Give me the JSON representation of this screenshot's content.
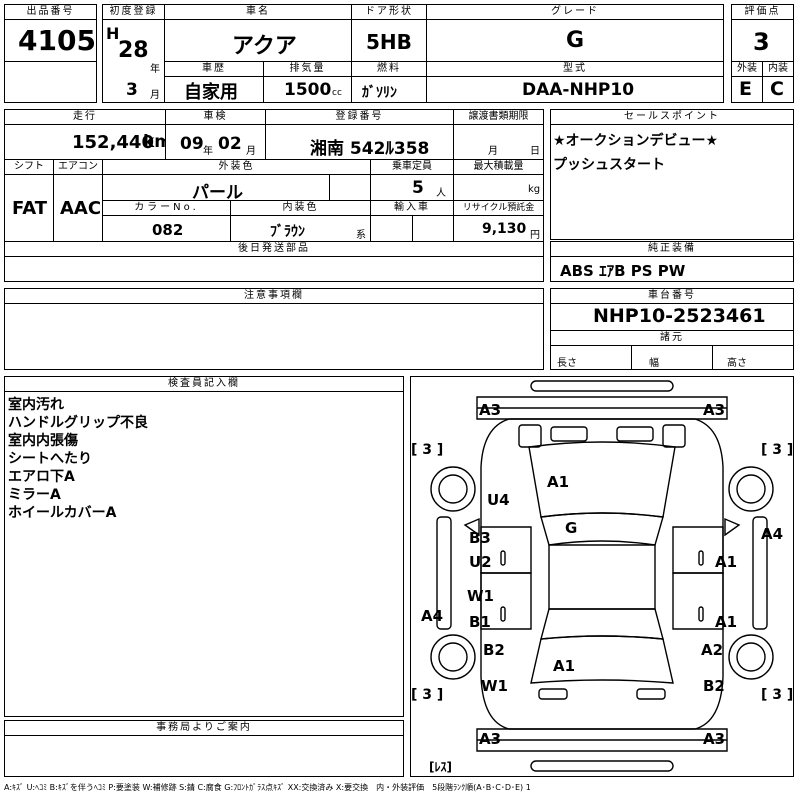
{
  "sheet": {
    "lot": {
      "label": "出品番号",
      "value": "4105"
    },
    "first_reg": {
      "label": "初度登録",
      "era": "H",
      "year": "28",
      "year_unit": "年",
      "month": "3",
      "month_unit": "月"
    },
    "car_name": {
      "label": "車名",
      "value": "アクア"
    },
    "door": {
      "label": "ドア形状",
      "value": "5HB"
    },
    "grade": {
      "label": "グレード",
      "value": "G"
    },
    "score": {
      "label": "評価点",
      "value": "3"
    },
    "history": {
      "label": "車歴",
      "value": "自家用"
    },
    "displacement": {
      "label": "排気量",
      "value": "1500",
      "unit": "cc"
    },
    "fuel": {
      "label": "燃料",
      "value": "ｶﾞｿﾘﾝ"
    },
    "model": {
      "label": "型式",
      "value": "DAA-NHP10"
    },
    "exterior": {
      "label": "外装",
      "value": "E"
    },
    "interior": {
      "label": "内装",
      "value": "C"
    },
    "mileage": {
      "label": "走行",
      "value": "152,440",
      "unit": "km"
    },
    "inspection": {
      "label": "車検",
      "year": "09",
      "year_unit": "年",
      "month": "02",
      "month_unit": "月"
    },
    "plate": {
      "label": "登録番号",
      "value": "湘南 542ﾙ358"
    },
    "transfer": {
      "label": "譲渡書類期限",
      "month_unit": "月",
      "day_unit": "日"
    },
    "sales_point": {
      "label": "セールスポイント",
      "lines": [
        "★オークションデビュー★",
        "プッシュスタート"
      ]
    },
    "shift": {
      "label": "シフト",
      "value": "FAT"
    },
    "aircon": {
      "label": "エアコン",
      "value": "AAC"
    },
    "color": {
      "label": "外装色",
      "value": "パール"
    },
    "capacity": {
      "label": "乗車定員",
      "value": "5",
      "unit": "人"
    },
    "max_load": {
      "label": "最大積載量",
      "unit": "kg"
    },
    "color_no": {
      "label": "カラーNo.",
      "value": "082"
    },
    "int_color": {
      "label": "内装色",
      "value": "ﾌﾞﾗｳﾝ",
      "suffix": "系"
    },
    "import": {
      "label": "輸入車"
    },
    "recycle": {
      "label": "リサイクル預託金",
      "value": "9,130",
      "unit": "円"
    },
    "later_parts": {
      "label": "後日発送部品"
    },
    "equipment": {
      "label": "純正装備",
      "value": "ABS ｴｱB PS PW"
    },
    "notes": {
      "label": "注意事項欄"
    },
    "chassis": {
      "label": "車台番号",
      "value": "NHP10-2523461"
    },
    "dims": {
      "label": "諸元",
      "length": "長さ",
      "width": "幅",
      "height": "高さ"
    },
    "inspector": {
      "label": "検査員記入欄",
      "lines": [
        "室内汚れ",
        "ハンドルグリップ不良",
        "室内内張傷",
        "シートへたり",
        "エアロ下A",
        "ミラーA",
        "ホイールカバーA"
      ]
    },
    "office": {
      "label": "事務局よりご案内"
    },
    "legend": "A:ｷｽﾞ U:ﾍｺﾐ B:ｷｽﾞを伴うﾍｺﾐ P:要塗装 W:補修跡 S:錆 C:腐食 G:ﾌﾛﾝﾄｶﾞﾗｽ点ｷｽﾞ XX:交換済み X:要交換　内・外装評価　5段階ﾗﾝｸ順(A･B･C･D･E) 1"
  },
  "diagram": {
    "marks": [
      {
        "id": "a3-fl",
        "text": "A3"
      },
      {
        "id": "a3-fr",
        "text": "A3"
      },
      {
        "id": "t3-l",
        "text": "[ 3 ]"
      },
      {
        "id": "t3-r",
        "text": "[ 3 ]"
      },
      {
        "id": "a1-hood",
        "text": "A1"
      },
      {
        "id": "u4",
        "text": "U4"
      },
      {
        "id": "g",
        "text": "G"
      },
      {
        "id": "a4-r",
        "text": "A4"
      },
      {
        "id": "b3",
        "text": "B3"
      },
      {
        "id": "u2",
        "text": "U2"
      },
      {
        "id": "a1-r1",
        "text": "A1"
      },
      {
        "id": "w1",
        "text": "W1"
      },
      {
        "id": "b1",
        "text": "B1"
      },
      {
        "id": "a4-l",
        "text": "A4"
      },
      {
        "id": "a1-r2",
        "text": "A1"
      },
      {
        "id": "b2-l",
        "text": "B2"
      },
      {
        "id": "a2",
        "text": "A2"
      },
      {
        "id": "a1-roof",
        "text": "A1"
      },
      {
        "id": "w1-l",
        "text": "W1"
      },
      {
        "id": "b2-r",
        "text": "B2"
      },
      {
        "id": "t3-bl",
        "text": "[ 3 ]"
      },
      {
        "id": "t3-br",
        "text": "[ 3 ]"
      },
      {
        "id": "a3-rl",
        "text": "A3"
      },
      {
        "id": "a3-rr",
        "text": "A3"
      },
      {
        "id": "res",
        "text": "[ﾚｽ]"
      }
    ]
  }
}
